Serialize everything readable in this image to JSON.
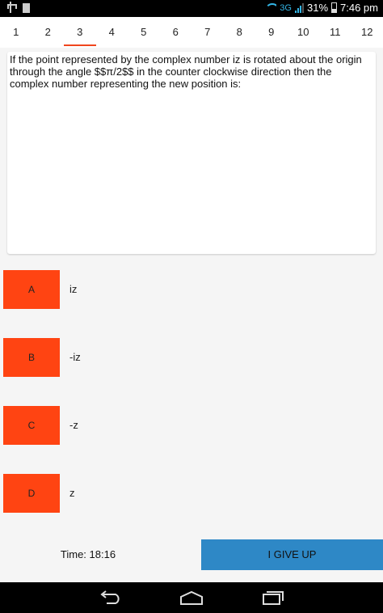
{
  "status": {
    "network": "3G",
    "battery": "31%",
    "time": "7:46 pm"
  },
  "tabs": [
    {
      "label": "1"
    },
    {
      "label": "2"
    },
    {
      "label": "3"
    },
    {
      "label": "4"
    },
    {
      "label": "5"
    },
    {
      "label": "6"
    },
    {
      "label": "7"
    },
    {
      "label": "8"
    },
    {
      "label": "9"
    },
    {
      "label": "10"
    },
    {
      "label": "11"
    },
    {
      "label": "12"
    }
  ],
  "active_tab": "3",
  "question": {
    "text": "If the point represented by the complex number iz is rotated about the origin through the angle $$π/2$$ in the counter clockwise direction then the complex number representing the new position is:"
  },
  "options": [
    {
      "letter": "A",
      "text": "iz"
    },
    {
      "letter": "B",
      "text": "-iz"
    },
    {
      "letter": "C",
      "text": "-z"
    },
    {
      "letter": "D",
      "text": "z"
    }
  ],
  "footer": {
    "timer": "Time: 18:16",
    "give_up": "I GIVE UP"
  },
  "colors": {
    "accent": "#ff4412",
    "tab_indicator": "#f0461e",
    "give_up_button": "#2e88c6"
  },
  "nav_icons": [
    "back-icon",
    "home-icon",
    "recents-icon"
  ]
}
